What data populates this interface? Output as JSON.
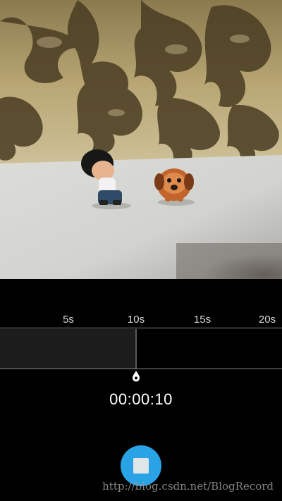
{
  "camera": {
    "preview_subject": "camera-preview"
  },
  "timeline": {
    "ticks": [
      "5s",
      "10s",
      "15s",
      "20s"
    ],
    "progress_seconds": 10,
    "max_seconds": 20
  },
  "timer": {
    "elapsed": "00:00:10"
  },
  "controls": {
    "stop_icon": "stop-icon",
    "accent_color": "#2aa3e6"
  },
  "watermark": {
    "text": "http://blog.csdn.net/BlogRecord"
  }
}
